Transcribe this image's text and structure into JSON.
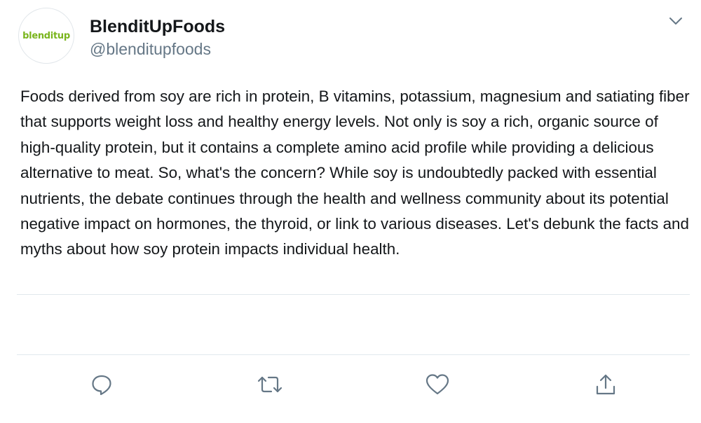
{
  "author": {
    "avatar_text": "blenditup",
    "display_name": "BlenditUpFoods",
    "handle": "@blenditupfoods"
  },
  "tweet": {
    "text": "Foods derived from soy are rich in protein, B vitamins, potassium, magnesium and satiating fiber that supports weight loss and healthy energy levels. Not only is soy a rich, organic source of high-quality protein, but it contains a complete amino acid profile while providing a delicious alternative to meat. So, what's the concern? While soy is undoubtedly packed with essential nutrients, the debate continues through the health and wellness community about its potential negative impact on hormones, the thyroid, or link to various diseases. Let's debunk the facts and myths about how soy protein impacts individual health."
  },
  "actions": {
    "reply_icon": "reply-icon",
    "retweet_icon": "retweet-icon",
    "like_icon": "heart-icon",
    "share_icon": "share-icon"
  },
  "colors": {
    "brand_green": "#7ab51d",
    "text": "#14171a",
    "secondary": "#657786",
    "icon": "#657786",
    "divider": "#e1e8ed"
  }
}
